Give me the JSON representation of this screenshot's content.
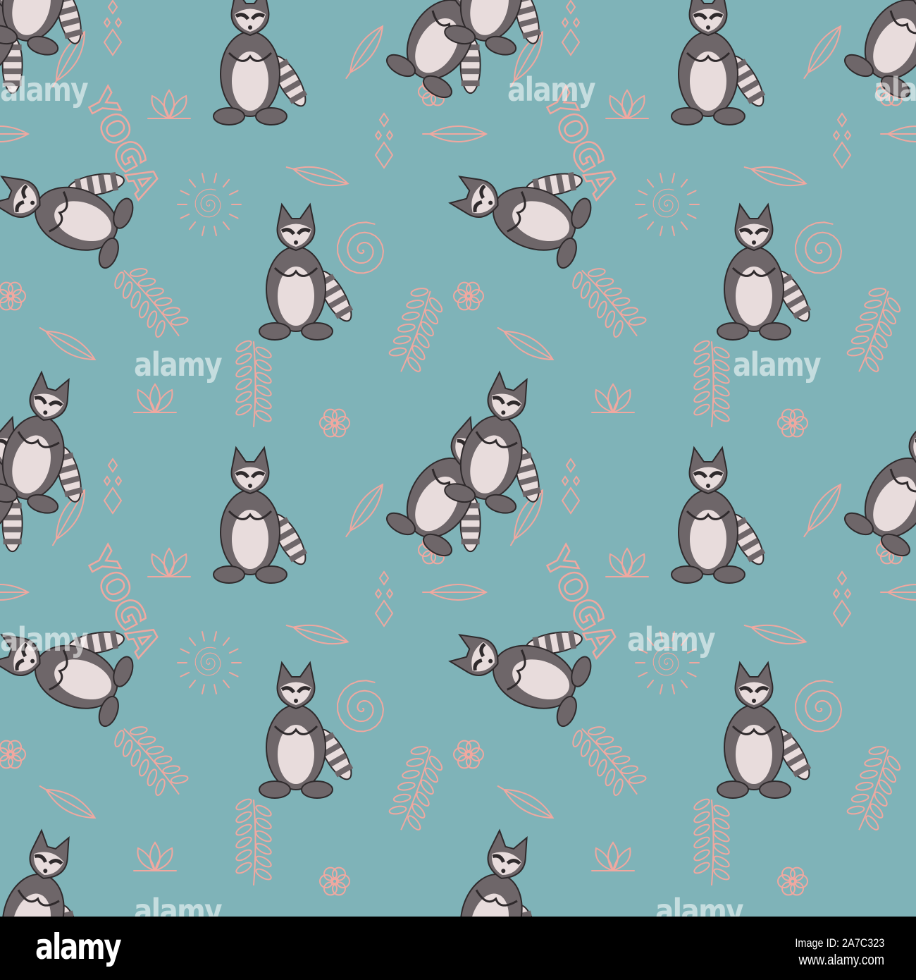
{
  "illustration": {
    "lettering": "YOGA",
    "colors": {
      "background": "#7fb3b8",
      "doodle": "#f0a8a0",
      "fur_dark": "#6e6669",
      "fur_light": "#e8dcdc",
      "outline": "#2f2a2c"
    }
  },
  "watermark": {
    "text": "alamy"
  },
  "footer": {
    "logo": "alamy",
    "image_id": "Image ID: 2A7C323",
    "url": "www.alamy.com"
  }
}
